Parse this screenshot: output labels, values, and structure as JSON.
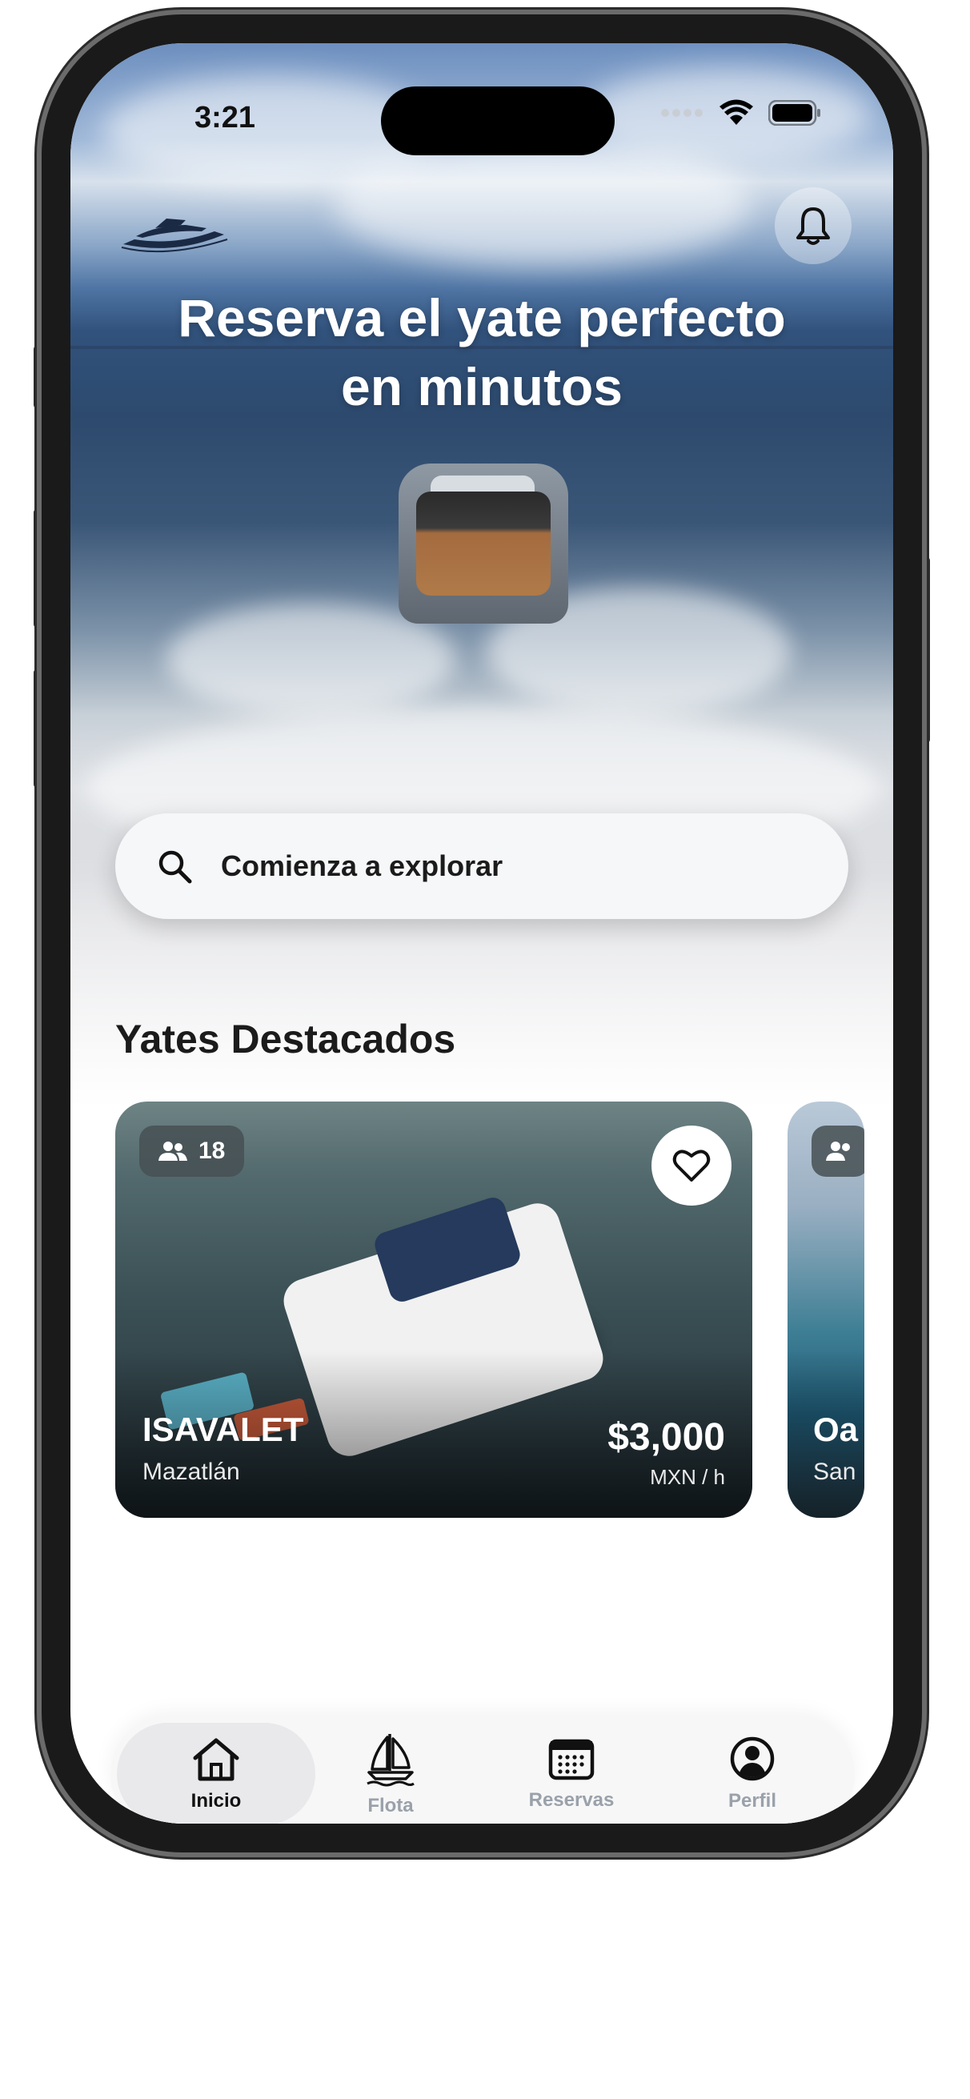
{
  "status_bar": {
    "time": "3:21"
  },
  "header": {
    "headline_line1": "Reserva el yate perfecto",
    "headline_line2": "en minutos"
  },
  "search": {
    "label": "Comienza a explorar"
  },
  "featured": {
    "title": "Yates Destacados",
    "cards": [
      {
        "capacity": "18",
        "name": "ISAVALET",
        "location": "Mazatlán",
        "price": "$3,000",
        "unit": "MXN / h"
      },
      {
        "capacity": "",
        "name": "Oa",
        "location": "San"
      }
    ]
  },
  "tabs": [
    {
      "label": "Inicio",
      "icon": "home-icon",
      "active": true
    },
    {
      "label": "Flota",
      "icon": "sailboat-icon",
      "active": false
    },
    {
      "label": "Reservas",
      "icon": "calendar-icon",
      "active": false
    },
    {
      "label": "Perfil",
      "icon": "profile-icon",
      "active": false
    }
  ],
  "colors": {
    "tab_active": "#111111",
    "tab_inactive": "#9aa1aa",
    "search_bg": "#f6f7f9"
  }
}
